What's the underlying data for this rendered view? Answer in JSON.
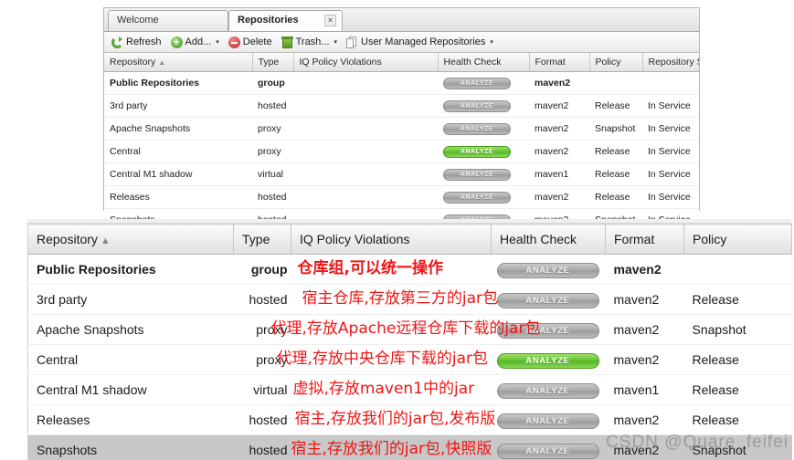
{
  "window": {
    "tabs": [
      {
        "label": "Welcome",
        "active": false,
        "closable": false
      },
      {
        "label": "Repositories",
        "active": true,
        "closable": true,
        "close_glyph": "×"
      }
    ],
    "toolbar": {
      "refresh_label": "Refresh",
      "add_label": "Add...",
      "delete_label": "Delete",
      "trash_label": "Trash...",
      "user_managed_label": "User Managed Repositories",
      "caret_glyph": "▾"
    }
  },
  "table": {
    "sort_caret": "▲",
    "columns": [
      "Repository",
      "Type",
      "IQ Policy Violations",
      "Health Check",
      "Format",
      "Policy",
      "Repository Status"
    ],
    "analyze_label": "ANALYZE",
    "rows": [
      {
        "repository": "Public Repositories",
        "type": "group",
        "iq": "",
        "health": "ANALYZE",
        "health_state": "gray",
        "format": "maven2",
        "policy": "",
        "status": "",
        "bold": true,
        "selected": false,
        "note": "仓库组,可以统一操作"
      },
      {
        "repository": "3rd party",
        "type": "hosted",
        "iq": "",
        "health": "ANALYZE",
        "health_state": "gray",
        "format": "maven2",
        "policy": "Release",
        "status": "In Service",
        "bold": false,
        "selected": false,
        "note": "宿主仓库,存放第三方的jar包"
      },
      {
        "repository": "Apache Snapshots",
        "type": "proxy",
        "iq": "",
        "health": "ANALYZE",
        "health_state": "gray",
        "format": "maven2",
        "policy": "Snapshot",
        "status": "In Service",
        "bold": false,
        "selected": false,
        "note": "代理,存放Apache远程仓库下载的jar包"
      },
      {
        "repository": "Central",
        "type": "proxy",
        "iq": "",
        "health": "ANALYZE",
        "health_state": "green",
        "format": "maven2",
        "policy": "Release",
        "status": "In Service",
        "bold": false,
        "selected": false,
        "note": "代理,存放中央仓库下载的jar包"
      },
      {
        "repository": "Central M1 shadow",
        "type": "virtual",
        "iq": "",
        "health": "ANALYZE",
        "health_state": "gray",
        "format": "maven1",
        "policy": "Release",
        "status": "In Service",
        "bold": false,
        "selected": false,
        "note": "虚拟,存放maven1中的jar"
      },
      {
        "repository": "Releases",
        "type": "hosted",
        "iq": "",
        "health": "ANALYZE",
        "health_state": "gray",
        "format": "maven2",
        "policy": "Release",
        "status": "In Service",
        "bold": false,
        "selected": false,
        "note": "宿主,存放我们的jar包,发布版"
      },
      {
        "repository": "Snapshots",
        "type": "hosted",
        "iq": "",
        "health": "ANALYZE",
        "health_state": "gray",
        "format": "maven2",
        "policy": "Snapshot",
        "status": "In Service",
        "bold": false,
        "selected": true,
        "note": "宿主,存放我们的jar包,快照版"
      }
    ]
  },
  "watermark": {
    "text": "CSDN @Quare_feifei"
  },
  "colors": {
    "annotation_red": "#f01414",
    "health_green": "#63c332",
    "health_gray": "#a8a8a8",
    "selected_row": "#c8c8c8"
  }
}
